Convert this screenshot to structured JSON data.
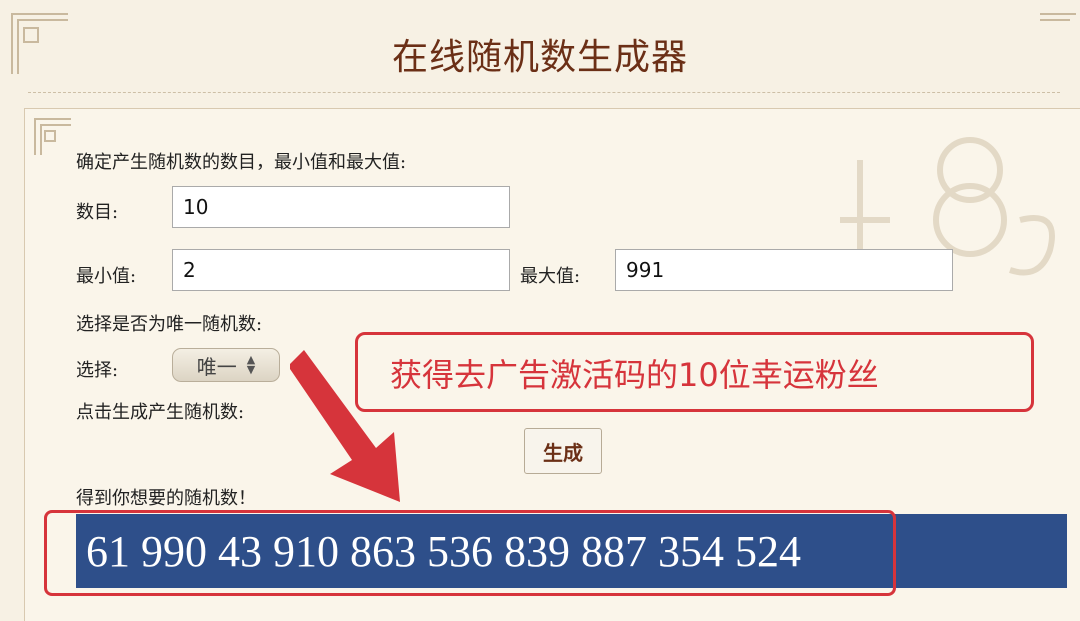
{
  "page": {
    "title": "在线随机数生成器"
  },
  "form": {
    "intro": "确定产生随机数的数目，最小值和最大值:",
    "count_label": "数目:",
    "count_value": "10",
    "min_label": "最小值:",
    "min_value": "2",
    "max_label": "最大值:",
    "max_value": "991",
    "unique_prompt": "选择是否为唯一随机数:",
    "select_label": "选择:",
    "select_value": "唯一",
    "generate_prompt": "点击生成产生随机数:",
    "generate_button": "生成",
    "result_label": "得到你想要的随机数！",
    "result_numbers": "61 990 43 910 863 536 839 887 354 524"
  },
  "annotation": {
    "callout_text": "获得去广告激活码的10位幸运粉丝"
  },
  "colors": {
    "title": "#6b2f16",
    "result_bar": "#2e4f8a",
    "annotation_red": "#d6343b",
    "background": "#f7f1e4"
  },
  "icons": [
    "corner-ornament-icon",
    "select-arrows-icon",
    "red-arrow-icon"
  ]
}
